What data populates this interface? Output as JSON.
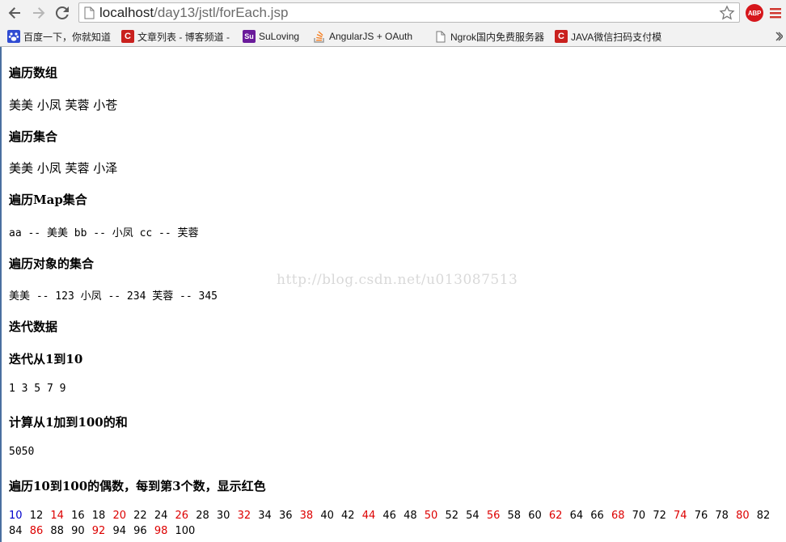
{
  "browser": {
    "url_host": "localhost",
    "url_path": "/day13/jstl/forEach.jsp",
    "extension_badge": "ABP",
    "bookmarks": [
      {
        "label": "百度一下，你就知道",
        "icon": "baidu-paw-icon"
      },
      {
        "label": "文章列表 - 博客频道 -",
        "icon": "csdn-icon"
      },
      {
        "label": "SuLoving",
        "icon": "suloving-icon"
      },
      {
        "label": "AngularJS + OAuth",
        "icon": "stackoverflow-icon"
      },
      {
        "label": "Ngrok国内免费服务器",
        "icon": "document-icon"
      },
      {
        "label": "JAVA微信扫码支付模",
        "icon": "csdn-icon"
      }
    ]
  },
  "page": {
    "sections": [
      {
        "heading": "遍历数组",
        "line": "美美 小凤 芙蓉 小苍"
      },
      {
        "heading": "遍历集合",
        "line": "美美 小凤 芙蓉 小泽"
      },
      {
        "heading": "遍历Map集合",
        "line": "aa -- 美美 bb -- 小凤 cc -- 芙蓉"
      },
      {
        "heading": "遍历对象的集合",
        "line": "美美 -- 123 小凤 -- 234 芙蓉 -- 345"
      },
      {
        "heading": "迭代数据"
      },
      {
        "heading": "迭代从1到10",
        "line": "1 3 5 7 9"
      },
      {
        "heading": "计算从1加到100的和",
        "line": "5050"
      },
      {
        "heading": "遍历10到100的偶数，每到第3个数，显示红色"
      }
    ],
    "watermark": "http://blog.csdn.net/u013087513",
    "even_numbers": [
      10,
      12,
      14,
      16,
      18,
      20,
      22,
      24,
      26,
      28,
      30,
      32,
      34,
      36,
      38,
      40,
      42,
      44,
      46,
      48,
      50,
      52,
      54,
      56,
      58,
      60,
      62,
      64,
      66,
      68,
      70,
      72,
      74,
      76,
      78,
      80,
      82,
      84,
      86,
      88,
      90,
      92,
      94,
      96,
      98,
      100
    ],
    "colors": {
      "first": "#0000cc",
      "highlight": "#dd0000",
      "normal": "#000000"
    }
  }
}
